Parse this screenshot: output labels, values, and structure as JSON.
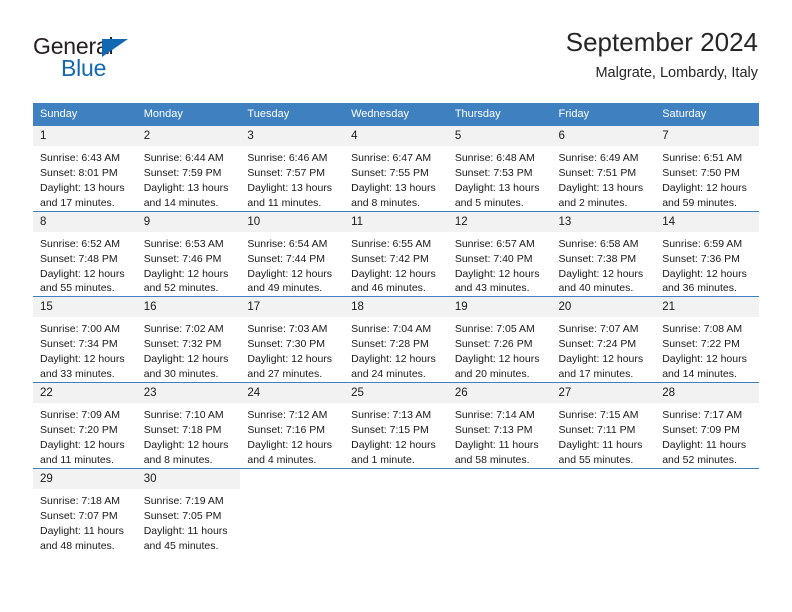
{
  "brand": {
    "name_part1": "General",
    "name_part2": "Blue",
    "colors": {
      "black": "#231f20",
      "blue": "#1268b3"
    }
  },
  "header": {
    "title": "September 2024",
    "subtitle": "Malgrate, Lombardy, Italy"
  },
  "theme": {
    "header_blue": "#3f80c1",
    "daynum_gray": "#f2f2f2",
    "text": "#1a1a1a"
  },
  "weekdays": [
    "Sunday",
    "Monday",
    "Tuesday",
    "Wednesday",
    "Thursday",
    "Friday",
    "Saturday"
  ],
  "labels": {
    "sunrise_prefix": "Sunrise:",
    "sunset_prefix": "Sunset:",
    "daylight_prefix": "Daylight:"
  },
  "weeks": [
    [
      {
        "day": "1",
        "sunrise": "Sunrise: 6:43 AM",
        "sunset": "Sunset: 8:01 PM",
        "daylight": "Daylight: 13 hours and 17 minutes."
      },
      {
        "day": "2",
        "sunrise": "Sunrise: 6:44 AM",
        "sunset": "Sunset: 7:59 PM",
        "daylight": "Daylight: 13 hours and 14 minutes."
      },
      {
        "day": "3",
        "sunrise": "Sunrise: 6:46 AM",
        "sunset": "Sunset: 7:57 PM",
        "daylight": "Daylight: 13 hours and 11 minutes."
      },
      {
        "day": "4",
        "sunrise": "Sunrise: 6:47 AM",
        "sunset": "Sunset: 7:55 PM",
        "daylight": "Daylight: 13 hours and 8 minutes."
      },
      {
        "day": "5",
        "sunrise": "Sunrise: 6:48 AM",
        "sunset": "Sunset: 7:53 PM",
        "daylight": "Daylight: 13 hours and 5 minutes."
      },
      {
        "day": "6",
        "sunrise": "Sunrise: 6:49 AM",
        "sunset": "Sunset: 7:51 PM",
        "daylight": "Daylight: 13 hours and 2 minutes."
      },
      {
        "day": "7",
        "sunrise": "Sunrise: 6:51 AM",
        "sunset": "Sunset: 7:50 PM",
        "daylight": "Daylight: 12 hours and 59 minutes."
      }
    ],
    [
      {
        "day": "8",
        "sunrise": "Sunrise: 6:52 AM",
        "sunset": "Sunset: 7:48 PM",
        "daylight": "Daylight: 12 hours and 55 minutes."
      },
      {
        "day": "9",
        "sunrise": "Sunrise: 6:53 AM",
        "sunset": "Sunset: 7:46 PM",
        "daylight": "Daylight: 12 hours and 52 minutes."
      },
      {
        "day": "10",
        "sunrise": "Sunrise: 6:54 AM",
        "sunset": "Sunset: 7:44 PM",
        "daylight": "Daylight: 12 hours and 49 minutes."
      },
      {
        "day": "11",
        "sunrise": "Sunrise: 6:55 AM",
        "sunset": "Sunset: 7:42 PM",
        "daylight": "Daylight: 12 hours and 46 minutes."
      },
      {
        "day": "12",
        "sunrise": "Sunrise: 6:57 AM",
        "sunset": "Sunset: 7:40 PM",
        "daylight": "Daylight: 12 hours and 43 minutes."
      },
      {
        "day": "13",
        "sunrise": "Sunrise: 6:58 AM",
        "sunset": "Sunset: 7:38 PM",
        "daylight": "Daylight: 12 hours and 40 minutes."
      },
      {
        "day": "14",
        "sunrise": "Sunrise: 6:59 AM",
        "sunset": "Sunset: 7:36 PM",
        "daylight": "Daylight: 12 hours and 36 minutes."
      }
    ],
    [
      {
        "day": "15",
        "sunrise": "Sunrise: 7:00 AM",
        "sunset": "Sunset: 7:34 PM",
        "daylight": "Daylight: 12 hours and 33 minutes."
      },
      {
        "day": "16",
        "sunrise": "Sunrise: 7:02 AM",
        "sunset": "Sunset: 7:32 PM",
        "daylight": "Daylight: 12 hours and 30 minutes."
      },
      {
        "day": "17",
        "sunrise": "Sunrise: 7:03 AM",
        "sunset": "Sunset: 7:30 PM",
        "daylight": "Daylight: 12 hours and 27 minutes."
      },
      {
        "day": "18",
        "sunrise": "Sunrise: 7:04 AM",
        "sunset": "Sunset: 7:28 PM",
        "daylight": "Daylight: 12 hours and 24 minutes."
      },
      {
        "day": "19",
        "sunrise": "Sunrise: 7:05 AM",
        "sunset": "Sunset: 7:26 PM",
        "daylight": "Daylight: 12 hours and 20 minutes."
      },
      {
        "day": "20",
        "sunrise": "Sunrise: 7:07 AM",
        "sunset": "Sunset: 7:24 PM",
        "daylight": "Daylight: 12 hours and 17 minutes."
      },
      {
        "day": "21",
        "sunrise": "Sunrise: 7:08 AM",
        "sunset": "Sunset: 7:22 PM",
        "daylight": "Daylight: 12 hours and 14 minutes."
      }
    ],
    [
      {
        "day": "22",
        "sunrise": "Sunrise: 7:09 AM",
        "sunset": "Sunset: 7:20 PM",
        "daylight": "Daylight: 12 hours and 11 minutes."
      },
      {
        "day": "23",
        "sunrise": "Sunrise: 7:10 AM",
        "sunset": "Sunset: 7:18 PM",
        "daylight": "Daylight: 12 hours and 8 minutes."
      },
      {
        "day": "24",
        "sunrise": "Sunrise: 7:12 AM",
        "sunset": "Sunset: 7:16 PM",
        "daylight": "Daylight: 12 hours and 4 minutes."
      },
      {
        "day": "25",
        "sunrise": "Sunrise: 7:13 AM",
        "sunset": "Sunset: 7:15 PM",
        "daylight": "Daylight: 12 hours and 1 minute."
      },
      {
        "day": "26",
        "sunrise": "Sunrise: 7:14 AM",
        "sunset": "Sunset: 7:13 PM",
        "daylight": "Daylight: 11 hours and 58 minutes."
      },
      {
        "day": "27",
        "sunrise": "Sunrise: 7:15 AM",
        "sunset": "Sunset: 7:11 PM",
        "daylight": "Daylight: 11 hours and 55 minutes."
      },
      {
        "day": "28",
        "sunrise": "Sunrise: 7:17 AM",
        "sunset": "Sunset: 7:09 PM",
        "daylight": "Daylight: 11 hours and 52 minutes."
      }
    ],
    [
      {
        "day": "29",
        "sunrise": "Sunrise: 7:18 AM",
        "sunset": "Sunset: 7:07 PM",
        "daylight": "Daylight: 11 hours and 48 minutes."
      },
      {
        "day": "30",
        "sunrise": "Sunrise: 7:19 AM",
        "sunset": "Sunset: 7:05 PM",
        "daylight": "Daylight: 11 hours and 45 minutes."
      },
      {
        "day": "",
        "sunrise": "",
        "sunset": "",
        "daylight": ""
      },
      {
        "day": "",
        "sunrise": "",
        "sunset": "",
        "daylight": ""
      },
      {
        "day": "",
        "sunrise": "",
        "sunset": "",
        "daylight": ""
      },
      {
        "day": "",
        "sunrise": "",
        "sunset": "",
        "daylight": ""
      },
      {
        "day": "",
        "sunrise": "",
        "sunset": "",
        "daylight": ""
      }
    ]
  ]
}
